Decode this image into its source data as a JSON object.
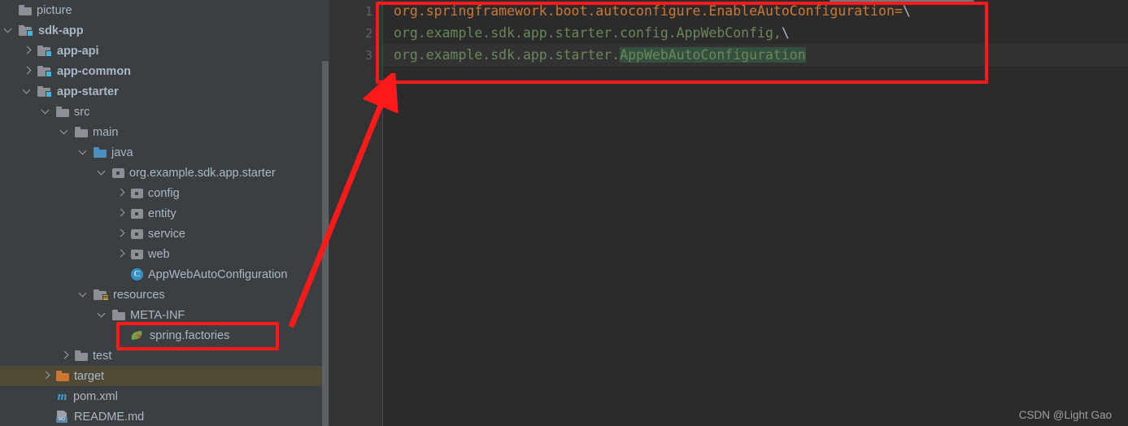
{
  "app": {
    "theme_bg": "#3C3F41",
    "editor_bg": "#2B2B2B",
    "accent_annotation": "#FF1A1A",
    "selected_row_bg": "#4E4A35",
    "watermark": "CSDN @Light Gao"
  },
  "project_tree": {
    "items": [
      {
        "label": "picture",
        "icon": "folder-icon",
        "twisty": "none",
        "indent": 0,
        "bold": false,
        "selected": false
      },
      {
        "label": "sdk-app",
        "icon": "module-folder-icon",
        "twisty": "down",
        "indent": 0,
        "bold": true,
        "selected": false
      },
      {
        "label": "app-api",
        "icon": "module-folder-icon",
        "twisty": "right",
        "indent": 1,
        "bold": true,
        "selected": false
      },
      {
        "label": "app-common",
        "icon": "module-folder-icon",
        "twisty": "right",
        "indent": 1,
        "bold": true,
        "selected": false
      },
      {
        "label": "app-starter",
        "icon": "module-folder-icon",
        "twisty": "down",
        "indent": 1,
        "bold": true,
        "selected": false
      },
      {
        "label": "src",
        "icon": "folder-icon",
        "twisty": "down",
        "indent": 2,
        "bold": false,
        "selected": false
      },
      {
        "label": "main",
        "icon": "folder-icon",
        "twisty": "down",
        "indent": 3,
        "bold": false,
        "selected": false
      },
      {
        "label": "java",
        "icon": "source-folder-icon",
        "twisty": "down",
        "indent": 4,
        "bold": false,
        "selected": false
      },
      {
        "label": "org.example.sdk.app.starter",
        "icon": "package-icon",
        "twisty": "down",
        "indent": 5,
        "bold": false,
        "selected": false
      },
      {
        "label": "config",
        "icon": "package-icon",
        "twisty": "right",
        "indent": 6,
        "bold": false,
        "selected": false
      },
      {
        "label": "entity",
        "icon": "package-icon",
        "twisty": "right",
        "indent": 6,
        "bold": false,
        "selected": false
      },
      {
        "label": "service",
        "icon": "package-icon",
        "twisty": "right",
        "indent": 6,
        "bold": false,
        "selected": false
      },
      {
        "label": "web",
        "icon": "package-icon",
        "twisty": "right",
        "indent": 6,
        "bold": false,
        "selected": false
      },
      {
        "label": "AppWebAutoConfiguration",
        "icon": "java-class-icon",
        "twisty": "none",
        "indent": 6,
        "bold": false,
        "selected": false
      },
      {
        "label": "resources",
        "icon": "resources-folder-icon",
        "twisty": "down",
        "indent": 4,
        "bold": false,
        "selected": false
      },
      {
        "label": "META-INF",
        "icon": "folder-icon",
        "twisty": "down",
        "indent": 5,
        "bold": false,
        "selected": false
      },
      {
        "label": "spring.factories",
        "icon": "spring-leaf-icon",
        "twisty": "none",
        "indent": 6,
        "bold": false,
        "selected": false
      },
      {
        "label": "test",
        "icon": "folder-icon",
        "twisty": "right",
        "indent": 3,
        "bold": false,
        "selected": false
      },
      {
        "label": "target",
        "icon": "folder-icon-orange",
        "twisty": "right",
        "indent": 2,
        "bold": false,
        "selected": true
      },
      {
        "label": "pom.xml",
        "icon": "maven-icon",
        "twisty": "none",
        "indent": 2,
        "bold": false,
        "selected": false
      },
      {
        "label": "README.md",
        "icon": "markdown-icon",
        "twisty": "none",
        "indent": 2,
        "bold": false,
        "selected": false
      }
    ]
  },
  "editor": {
    "line_numbers": [
      "1",
      "2",
      "3"
    ],
    "lines": [
      {
        "number": "1",
        "current": false,
        "segments": [
          {
            "text": "org.springframework.boot.autoconfigure.EnableAutoConfiguration=",
            "style": "key"
          },
          {
            "text": "\\",
            "style": "esc"
          }
        ]
      },
      {
        "number": "2",
        "current": false,
        "segments": [
          {
            "text": "org.example.sdk.app.starter.config.AppWebConfig,",
            "style": "val"
          },
          {
            "text": "\\",
            "style": "esc"
          }
        ]
      },
      {
        "number": "3",
        "current": true,
        "segments": [
          {
            "text": "org.example.sdk.app.starter.",
            "style": "val"
          },
          {
            "text": "AppWebAutoConfiguration",
            "style": "val-highlight"
          }
        ]
      }
    ],
    "colors": {
      "key": "#CC7832",
      "value": "#6A8759",
      "escape": "#A9B7C6",
      "search_highlight_bg": "#35503F",
      "current_line_bg": "#323232",
      "gutter_bg": "#313335",
      "line_number": "#606366"
    }
  },
  "annotations": {
    "code_box_label": "highlighted-code-block",
    "file_box_label": "highlighted-spring-factories-file",
    "arrow_label": "arrow-from-file-to-code"
  }
}
